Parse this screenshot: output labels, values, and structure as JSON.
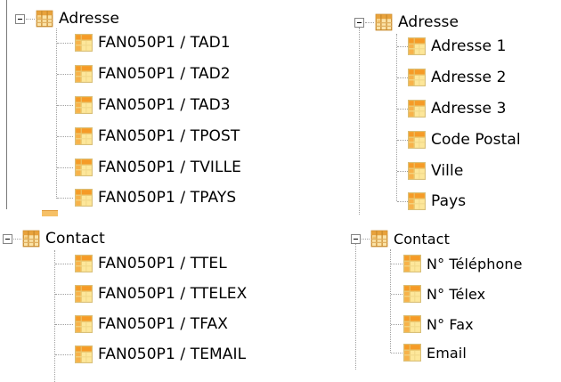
{
  "panels": {
    "top_left": {
      "parent": {
        "label": "Adresse",
        "icon": "table-icon",
        "expanded": true
      },
      "children": [
        {
          "label": "FAN050P1 / TAD1",
          "icon": "field-icon"
        },
        {
          "label": "FAN050P1 / TAD2",
          "icon": "field-icon"
        },
        {
          "label": "FAN050P1 / TAD3",
          "icon": "field-icon"
        },
        {
          "label": "FAN050P1 / TPOST",
          "icon": "field-icon"
        },
        {
          "label": "FAN050P1 / TVILLE",
          "icon": "field-icon"
        },
        {
          "label": "FAN050P1 / TPAYS",
          "icon": "field-icon"
        }
      ]
    },
    "top_right": {
      "parent": {
        "label": "Adresse",
        "icon": "table-icon",
        "expanded": true
      },
      "children": [
        {
          "label": "Adresse 1",
          "icon": "field-icon"
        },
        {
          "label": "Adresse 2",
          "icon": "field-icon"
        },
        {
          "label": "Adresse 3",
          "icon": "field-icon"
        },
        {
          "label": "Code Postal",
          "icon": "field-icon"
        },
        {
          "label": "Ville",
          "icon": "field-icon"
        },
        {
          "label": "Pays",
          "icon": "field-icon"
        }
      ]
    },
    "bottom_left": {
      "parent": {
        "label": "Contact",
        "icon": "table-icon",
        "expanded": true
      },
      "children": [
        {
          "label": "FAN050P1 / TTEL",
          "icon": "field-icon"
        },
        {
          "label": "FAN050P1 / TTELEX",
          "icon": "field-icon"
        },
        {
          "label": "FAN050P1 / TFAX",
          "icon": "field-icon"
        },
        {
          "label": "FAN050P1 / TEMAIL",
          "icon": "field-icon"
        }
      ]
    },
    "bottom_right": {
      "parent": {
        "label": "Contact",
        "icon": "table-icon",
        "expanded": true
      },
      "children": [
        {
          "label": "N° Téléphone",
          "icon": "field-icon"
        },
        {
          "label": "N° Télex",
          "icon": "field-icon"
        },
        {
          "label": "N° Fax",
          "icon": "field-icon"
        },
        {
          "label": "Email",
          "icon": "field-icon"
        }
      ]
    }
  },
  "colors": {
    "tree_line": "#a0a0a0",
    "field_icon_orange": "#f59b27",
    "field_icon_yellow": "#fde79a",
    "table_icon_grid": "#e8a23c"
  }
}
